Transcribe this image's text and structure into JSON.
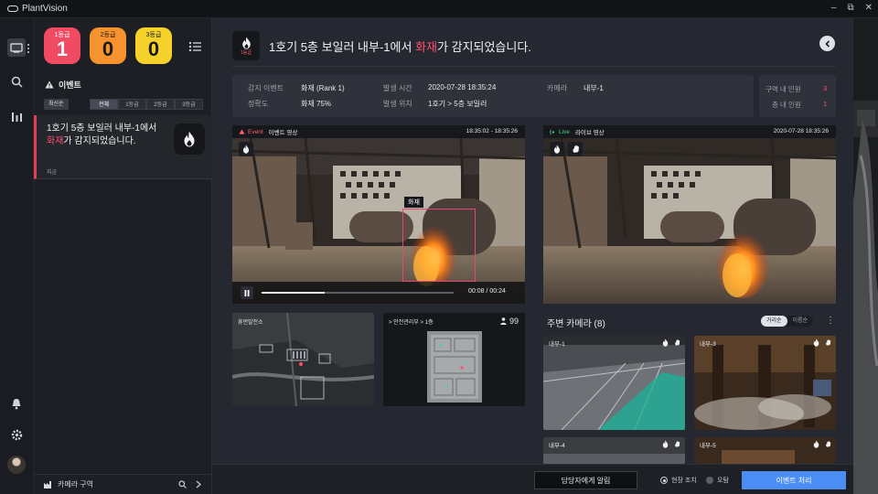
{
  "app": {
    "brand": "PlantVision",
    "window_controls": [
      "min-icon",
      "restore-icon",
      "close-icon"
    ]
  },
  "rail": {
    "items": [
      "monitor-icon",
      "search-icon",
      "chart-icon",
      "bell-icon",
      "gear-icon",
      "avatar"
    ]
  },
  "counts": [
    {
      "label": "1등급",
      "value": "1",
      "color": "#f14a63"
    },
    {
      "label": "2등급",
      "value": "0",
      "color": "#f7932f"
    },
    {
      "label": "3등급",
      "value": "0",
      "color": "#f5d22b"
    }
  ],
  "events": {
    "title": "이벤트",
    "sort_label": "최신순",
    "filters": [
      "전체",
      "1등급",
      "2등급",
      "3등급"
    ],
    "card": {
      "text_pre": "1호기 5층 보일러 내부-1에서 ",
      "text_hl": "화재",
      "text_post": "가 감지되었습니다.",
      "time": "지금"
    },
    "footer": "카메라 구역"
  },
  "header": {
    "rank_label": "1등급",
    "title_pre": "1호기 5층 보일러 내부-1에서 ",
    "title_hl": "화재",
    "title_post": "가 감지되었습니다."
  },
  "info": {
    "event_label": "감지 이벤트",
    "event_value": "화재 (Rank 1)",
    "accuracy_label": "정확도",
    "accuracy_value": "화재 75%",
    "time_label": "발생 시간",
    "time_value": "2020-07-28  18:35:24",
    "location_label": "발생 위치",
    "location_value": "1호기 > 5층 보일러",
    "camera_label": "카메라",
    "camera_value": "내부-1"
  },
  "staff": {
    "zone_label": "구역 내 인원",
    "zone_value": "3",
    "floor_label": "층 내 인원",
    "floor_value": "1"
  },
  "event_video": {
    "tag": "Event",
    "title": "이벤트 영상",
    "range": "18:35:02 - 18:35:26",
    "detect_label": "화재",
    "elapsed": "00:08",
    "duration": "00:24",
    "progress": 0.33
  },
  "live_video": {
    "tag": "Live",
    "title": "라이브 영상",
    "timestamp": "2020-07-28  18:35:26"
  },
  "maps": {
    "site_label": "휴먼발전소",
    "floor_label": "> 안전관리부 > 1층",
    "people_count": "99"
  },
  "nearby": {
    "title": "주변 카메라 (8)",
    "sort_options": [
      "거리순",
      "이름순"
    ],
    "cameras": [
      "내부-1",
      "내부-3",
      "내부-4",
      "내부-5"
    ]
  },
  "actions": {
    "notify": "담당자에게 알림",
    "option_onsite": "현장 조치",
    "option_false": "오탐",
    "process": "이벤트 처리"
  }
}
